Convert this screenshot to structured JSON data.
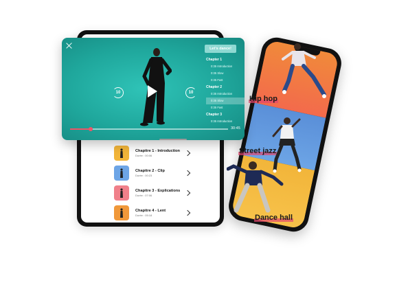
{
  "player": {
    "cta_label": "Let's dance!",
    "skip_back": "10",
    "skip_forward": "10",
    "progress_fraction": 0.13,
    "duration": "30:45",
    "chapters_menu": [
      {
        "label": "Chapter 1",
        "items": [
          {
            "label": "0:35 Introduction",
            "active": false
          },
          {
            "label": "0:35 Slow",
            "active": false
          },
          {
            "label": "0:35 Fast",
            "active": false
          }
        ]
      },
      {
        "label": "Chapter 2",
        "items": [
          {
            "label": "0:35 Introduction",
            "active": false
          },
          {
            "label": "0:35 Slow",
            "active": true
          },
          {
            "label": "0:35 Fast",
            "active": false
          }
        ]
      },
      {
        "label": "Chapter 3",
        "items": [
          {
            "label": "0:35 Introduction",
            "active": false
          }
        ]
      }
    ]
  },
  "chapter_list": [
    {
      "title": "Chapitre 1 - Introduction",
      "duration": "Durée : 00:06",
      "thumb_color": "#f2b53a"
    },
    {
      "title": "Chapitre 2 - Clip",
      "duration": "Durée : 00:23",
      "thumb_color": "#6da5e6"
    },
    {
      "title": "Chapitre 3 - Explications",
      "duration": "Durée : 07:06",
      "thumb_color": "#f0808a"
    },
    {
      "title": "Chapitre 4 - Lent",
      "duration": "Durée : 05:18",
      "thumb_color": "#f0983a"
    }
  ],
  "styles": {
    "hip_hop": "Hip hop",
    "street_jazz": "Street jazz",
    "dance_hall": "Dance hall"
  },
  "colors": {
    "player_bg": "#1fa79c",
    "accent": "#f0556a"
  }
}
